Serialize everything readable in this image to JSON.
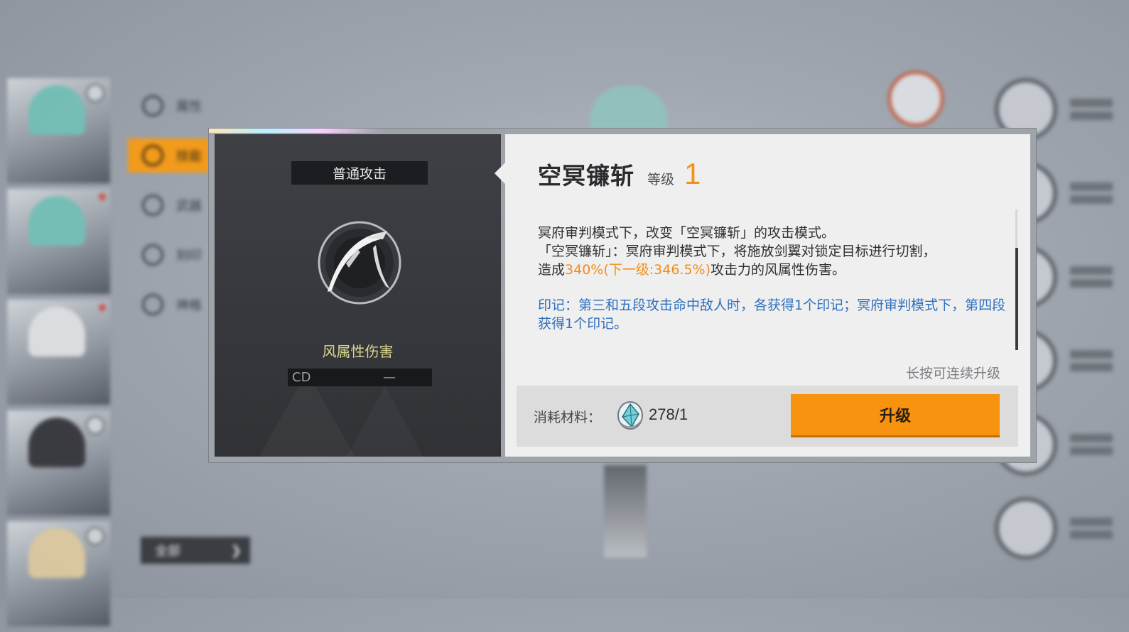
{
  "background": {
    "menu_items": [
      {
        "label": "属性",
        "active": false
      },
      {
        "label": "技能",
        "active": true
      },
      {
        "label": "武器",
        "active": false
      },
      {
        "label": "刻印",
        "active": false
      },
      {
        "label": "神格",
        "active": false
      }
    ],
    "filter_label": "全部",
    "roster_count": 5
  },
  "modal": {
    "skill_type": "普通攻击",
    "damage_type": "风属性伤害",
    "cd_label": "CD",
    "cd_value": "—",
    "skill_name": "空冥镰斩",
    "level_label": "等级",
    "level_value": "1",
    "description": {
      "line1": "冥府审判模式下，改变「空冥镰斩」的攻击模式。",
      "line2": "「空冥镰斩」：冥府审判模式下，将施放剑翼对锁定目标进行切割，",
      "line3_prefix": "造成",
      "line3_highlight": "340%(下一级:346.5%)",
      "line3_suffix": "攻击力的风属性伤害。",
      "mark_text": "印记：第三和五段攻击命中敌人时，各获得1个印记；冥府审判模式下，第四段获得1个印记。"
    },
    "hold_hint": "长按可连续升级",
    "cost_label": "消耗材料：",
    "cost_amount": "278/1",
    "upgrade_label": "升级"
  },
  "colors": {
    "accent_orange": "#f7930f",
    "highlight_orange": "#f28d1a",
    "mark_blue": "#2f6fbf",
    "damage_yellow": "#d9d68f"
  },
  "icons": {
    "skill": "scythe-icon",
    "material": "crystal-material-icon"
  }
}
